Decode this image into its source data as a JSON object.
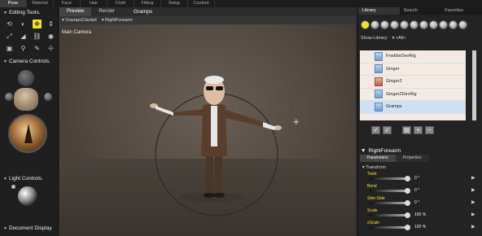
{
  "room_tabs": [
    "Pose",
    "Material",
    "Face",
    "Hair",
    "Cloth",
    "Fitting",
    "Setup",
    "Content"
  ],
  "left_panel": {
    "editing_tools": "Editing Tools.",
    "camera_controls": "Camera Controls.",
    "light_controls": "Light Controls.",
    "document_display": "Document Display"
  },
  "viewport": {
    "tabs": [
      "Preview",
      "Render"
    ],
    "title": "Gramps",
    "figure_menu": "Gramps2Jacket",
    "actor_menu": "RightForearm",
    "camera_label": "Main Camera"
  },
  "library": {
    "tabs": [
      "Library",
      "Search",
      "Favorites"
    ],
    "show_label": "Show Library:",
    "show_value": "<All>",
    "items": [
      {
        "name": "FreddieDevRig"
      },
      {
        "name": "Ginger"
      },
      {
        "name": "Ginger2"
      },
      {
        "name": "Ginger2DevRig"
      },
      {
        "name": "Gramps"
      }
    ]
  },
  "parameters": {
    "actor": "RightForearm",
    "tabs": [
      "Parameters",
      "Properties"
    ],
    "group": "Transform",
    "items": [
      {
        "name": "Twist",
        "value": "0 °"
      },
      {
        "name": "Bend",
        "value": "0 °"
      },
      {
        "name": "Side-Side",
        "value": "0 °"
      },
      {
        "name": "Scale",
        "value": "100 %"
      },
      {
        "name": "xScale",
        "value": "100 %"
      }
    ]
  },
  "colors": {
    "accent": "#f2e22a",
    "library_bg": "#f3ebe3"
  }
}
